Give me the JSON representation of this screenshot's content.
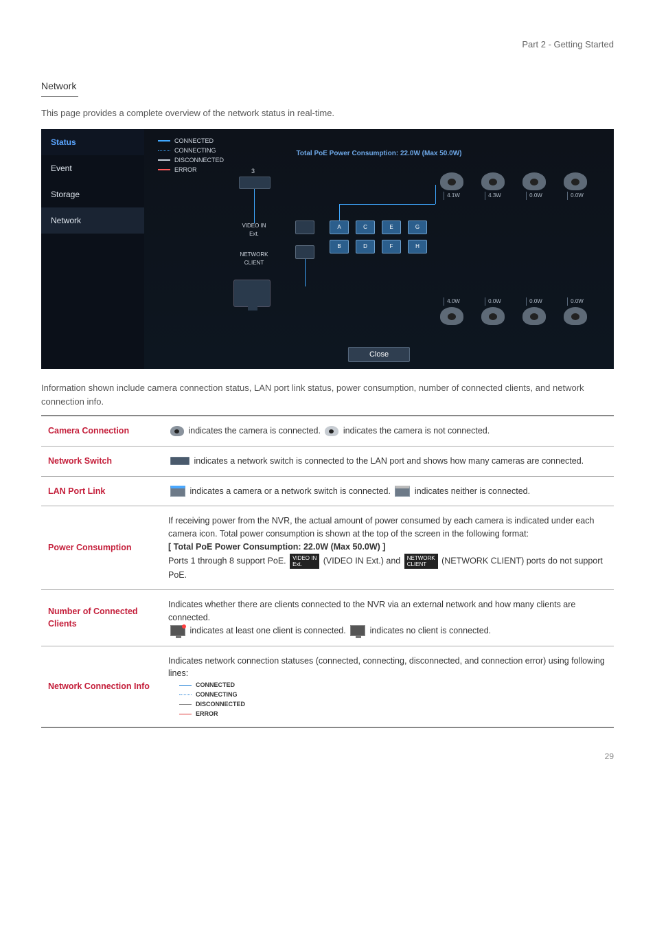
{
  "breadcrumb": "Part 2 - Getting Started",
  "section": "Network",
  "intro": "This page provides a complete overview of the network status in real-time.",
  "shot": {
    "tabs": {
      "status": "Status",
      "event": "Event",
      "storage": "Storage",
      "network": "Network"
    },
    "legend": {
      "connected": "CONNECTED",
      "connecting": "CONNECTING",
      "disconnected": "DISCONNECTED",
      "error": "ERROR"
    },
    "poe_title": "Total PoE Power Consumption: 22.0W (Max 50.0W)",
    "switch_count": "3",
    "label_ext": "VIDEO IN\nExt.",
    "label_net": "NETWORK\nCLIENT",
    "ports": [
      "A",
      "C",
      "E",
      "G",
      "B",
      "D",
      "F",
      "H"
    ],
    "power_top": [
      "4.1W",
      "4.3W",
      "0.0W",
      "0.0W"
    ],
    "power_bot": [
      "4.0W",
      "0.0W",
      "0.0W",
      "0.0W"
    ],
    "close": "Close"
  },
  "midtext": "Information shown include camera connection status, LAN port link status, power consumption, number of connected clients, and network connection info.",
  "rows": {
    "camera": {
      "h": "Camera Connection",
      "t1": " indicates the camera is connected. ",
      "t2": " indicates the camera is not connected."
    },
    "switch": {
      "h": "Network Switch",
      "t": " indicates a network switch is connected to the LAN port and shows how many cameras are connected."
    },
    "lan": {
      "h": "LAN Port Link",
      "t1": " indicates a camera or a network switch is connected. ",
      "t2": " indicates neither is connected."
    },
    "power": {
      "h": "Power Consumption",
      "p1": "If receiving power from the NVR, the actual amount of power consumed by each camera is indicated under each camera icon. Total power consumption is shown at the top of the screen in the following format:",
      "p2": "[ Total PoE Power Consumption: 22.0W (Max 50.0W) ]",
      "p3a": "Ports 1 through 8 support PoE. ",
      "badge1": "VIDEO IN\nExt.",
      "p3b": " (VIDEO IN Ext.) and ",
      "badge2": "NETWORK\nCLIENT",
      "p3c": " (NETWORK CLIENT) ports do not support PoE."
    },
    "clients": {
      "h": "Number of Connected Clients",
      "p1": "Indicates whether there are clients connected to the NVR via an external network and how many clients are connected.",
      "t1": " indicates at least one client is connected. ",
      "t2": " indicates no client is connected."
    },
    "netinfo": {
      "h": "Network Connection Info",
      "p": "Indicates network connection statuses (connected, connecting, disconnected, and connection error) using following lines:",
      "s1": "CONNECTED",
      "s2": "CONNECTING",
      "s3": "DISCONNECTED",
      "s4": "ERROR"
    }
  },
  "pagenum": "29"
}
